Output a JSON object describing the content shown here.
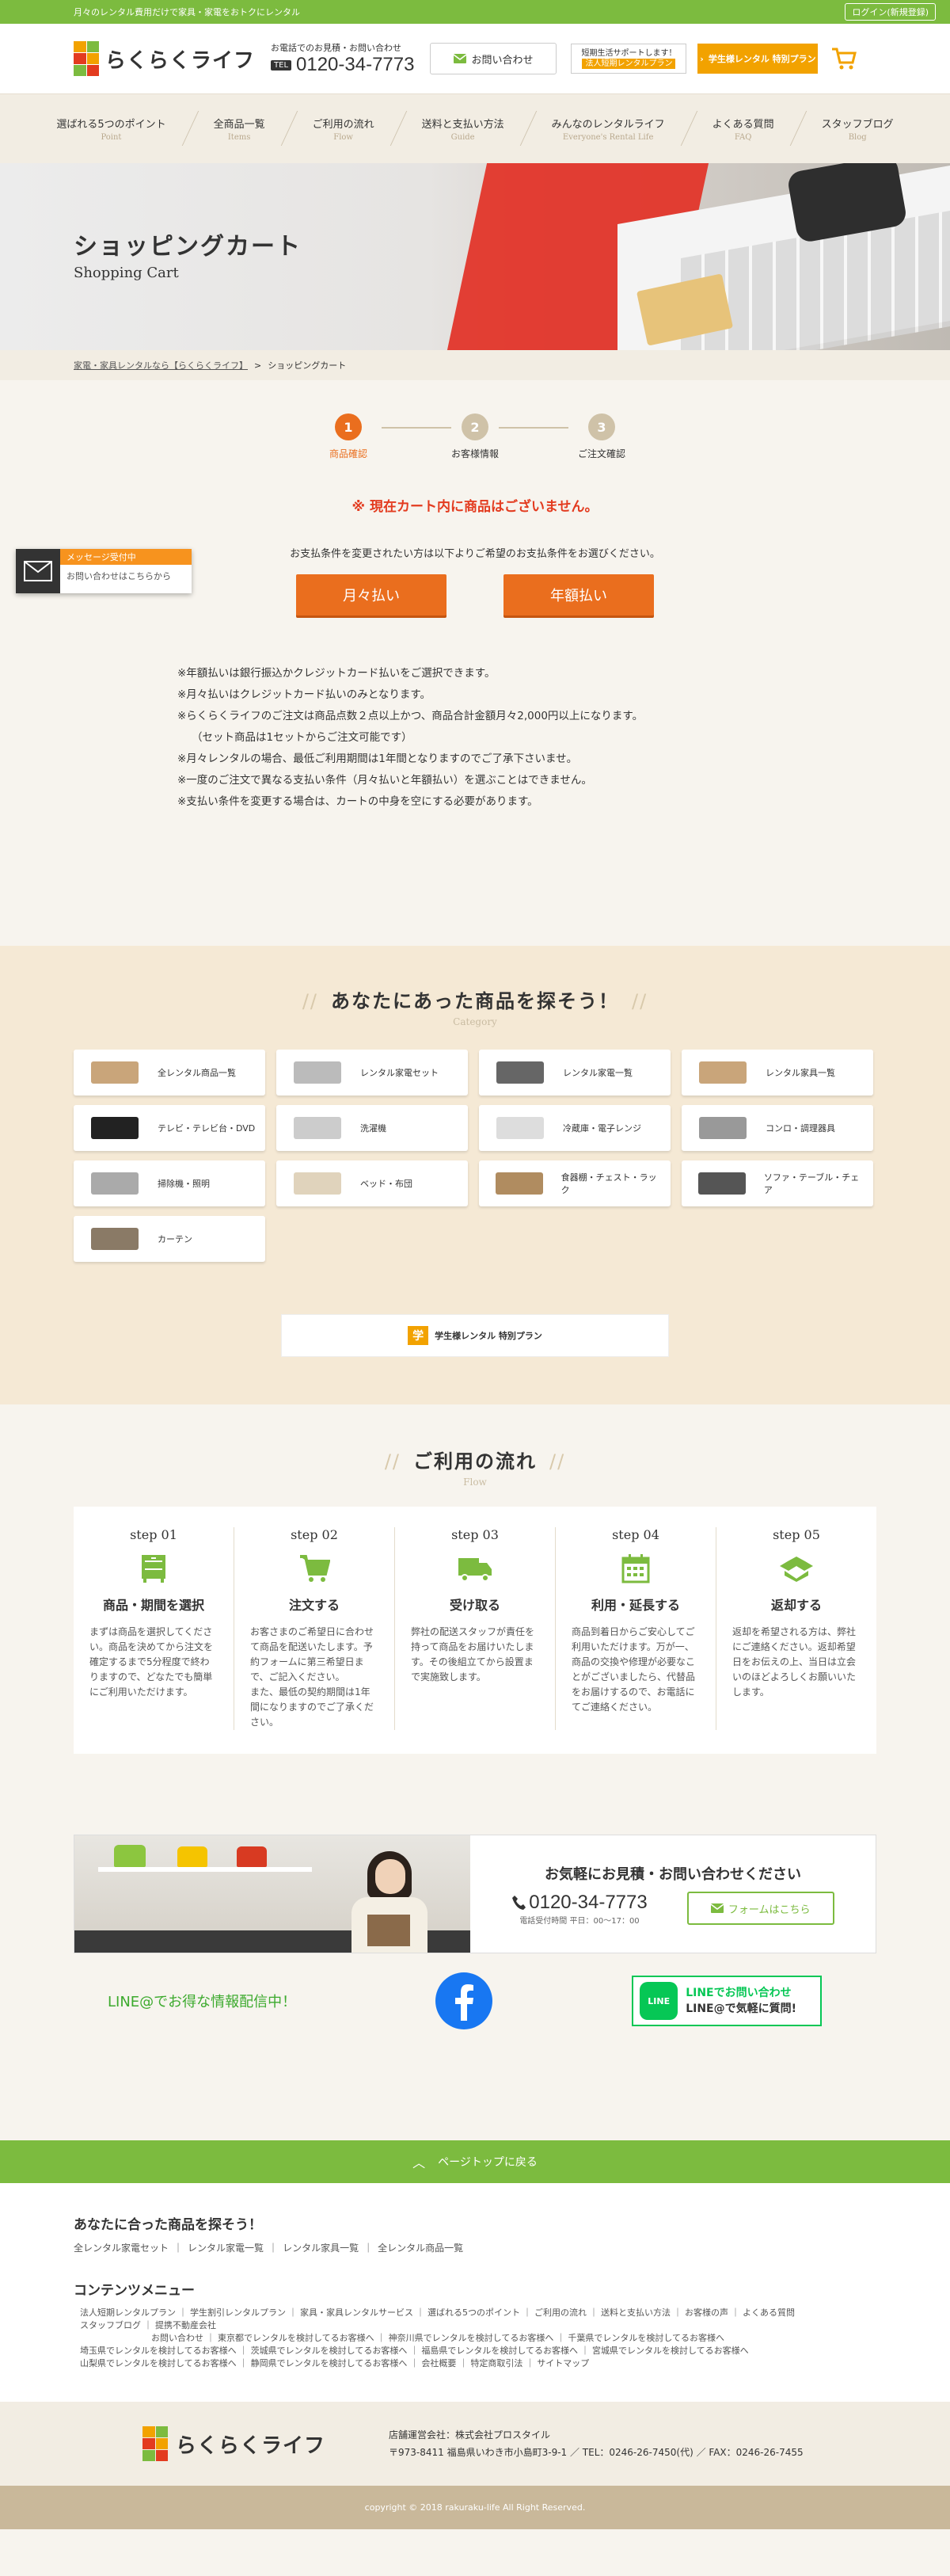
{
  "topbar": {
    "tagline": "月々のレンタル費用だけで家具・家電をおトクにレンタル",
    "login": "ログイン(新規登録)"
  },
  "header": {
    "logo_text": "らくらくライフ",
    "tel_caption": "お電話でのお見積・お問い合わせ",
    "tel_badge": "TEL",
    "tel_number": "0120-34-7773",
    "contact_label": "お問い合わせ",
    "short_banner_line1": "短期生活サポートします！",
    "short_banner_line2": "法人短期レンタルプラン",
    "student_banner": "学生様レンタル 特別プラン"
  },
  "nav": [
    {
      "ja": "選ばれる5つのポイント",
      "en": "Point"
    },
    {
      "ja": "全商品一覧",
      "en": "Items"
    },
    {
      "ja": "ご利用の流れ",
      "en": "Flow"
    },
    {
      "ja": "送料と支払い方法",
      "en": "Guide"
    },
    {
      "ja": "みんなのレンタルライフ",
      "en": "Everyone's Rental Life"
    },
    {
      "ja": "よくある質問",
      "en": "FAQ"
    },
    {
      "ja": "スタッフブログ",
      "en": "Blog"
    }
  ],
  "hero": {
    "title": "ショッピングカート",
    "subtitle": "Shopping Cart"
  },
  "breadcrumb": {
    "home": "家電・家具レンタルなら【らくらくライフ】",
    "sep": ">",
    "current": "ショッピングカート"
  },
  "steps": [
    {
      "num": "1",
      "label": "商品確認"
    },
    {
      "num": "2",
      "label": "お客様情報"
    },
    {
      "num": "3",
      "label": "ご注文確認"
    }
  ],
  "cart": {
    "empty_notice": "※ 現在カート内に商品はございません。",
    "pay_info": "お支払条件を変更されたい方は以下よりご希望のお支払条件をお選びください。",
    "monthly_btn": "月々払い",
    "yearly_btn": "年額払い",
    "notes": [
      "※年額払いは銀行振込かクレジットカード払いをご選択できます。",
      "※月々払いはクレジットカード払いのみとなります。",
      "※らくらくライフのご注文は商品点数２点以上かつ、商品合計金額月々2,000円以上になります。",
      "（セット商品は1セットからご注文可能です）",
      "※月々レンタルの場合、最低ご利用期間は1年間となりますのでご了承下さいませ。",
      "※一度のご注文で異なる支払い条件（月々払いと年額払い）を選ぶことはできません。",
      "※支払い条件を変更する場合は、カートの中身を空にする必要があります。"
    ]
  },
  "message_widget": {
    "status": "メッセージ受付中",
    "text": "お問い合わせはこちらから"
  },
  "category": {
    "title": "あなたにあった商品を探そう！",
    "subtitle": "Category",
    "items": [
      "全レンタル商品一覧",
      "レンタル家電セット",
      "レンタル家電一覧",
      "レンタル家具一覧",
      "テレビ・テレビ台・DVD",
      "洗濯機",
      "冷蔵庫・電子レンジ",
      "コンロ・調理器具",
      "掃除機・照明",
      "ベッド・布団",
      "食器棚・チェスト・ラック",
      "ソファ・テーブル・チェア",
      "カーテン"
    ]
  },
  "flow": {
    "title": "ご利用の流れ",
    "subtitle": "Flow",
    "steps": [
      {
        "num": "step 01",
        "title": "商品・期間を選択",
        "desc": "まずは商品を選択してください。商品を決めてから注文を確定するまで5分程度で終わりますので、どなたでも簡単にご利用いただけます。"
      },
      {
        "num": "step 02",
        "title": "注文する",
        "desc": "お客さまのご希望日に合わせて商品を配送いたします。予約フォームに第三希望日まで、ご記入ください。\nまた、最低の契約期間は1年間になりますのでご了承ください。"
      },
      {
        "num": "step 03",
        "title": "受け取る",
        "desc": "弊社の配送スタッフが責任を持って商品をお届けいたします。その後組立てから設置まで実施致します。"
      },
      {
        "num": "step 04",
        "title": "利用・延長する",
        "desc": "商品到着日からご安心してご利用いただけます。万が一、商品の交換や修理が必要なことがございましたら、代替品をお届けするので、お電話にてご連絡ください。"
      },
      {
        "num": "step 05",
        "title": "返却する",
        "desc": "返却を希望される方は、弊社にご連絡ください。返却希望日をお伝えの上、当日は立会いのほどよろしくお願いいたします。"
      }
    ]
  },
  "contact": {
    "title": "お気軽にお見積・お問い合わせください",
    "tel": "0120-34-7773",
    "hours": "電話受付時間 平日：00～17：00",
    "form_btn": "フォームはこちら"
  },
  "sns": {
    "line_text": "LINE@でお得な情報配信中！",
    "line_btn1": "LINEでお問い合わせ",
    "line_btn2": "LINE@で気軽に質問!"
  },
  "pagetop": "ページトップに戻る",
  "footer": {
    "find_title": "あなたに合った商品を探そう！",
    "find_links": [
      "全レンタル家電セット",
      "レンタル家電一覧",
      "レンタル家具一覧",
      "全レンタル商品一覧"
    ],
    "menu_title": "コンテンツメニュー",
    "menu_rows": [
      "法人短期レンタルプラン ｜ 学生割引レンタルプラン ｜ 家具・家具レンタルサービス ｜ 選ばれる5つのポイント ｜ ご利用の流れ ｜ 送料と支払い方法 ｜ お客様の声 ｜ よくある質問",
      "スタッフブログ ｜ 提携不動産会社",
      "お問い合わせ ｜ 東京都でレンタルを検討してるお客様へ ｜ 神奈川県でレンタルを検討してるお客様へ ｜ 千葉県でレンタルを検討してるお客様へ",
      "埼玉県でレンタルを検討してるお客様へ ｜ 茨城県でレンタルを検討してるお客様へ ｜ 福島県でレンタルを検討してるお客様へ ｜ 宮城県でレンタルを検討してるお客様へ",
      "山梨県でレンタルを検討してるお客様へ ｜ 静岡県でレンタルを検討してるお客様へ ｜ 会社概要 ｜ 特定商取引法 ｜ サイトマップ"
    ],
    "logo_text": "らくらくライフ",
    "company": "店舗運営会社：株式会社プロスタイル",
    "address": "〒973-8411 福島県いわき市小島町3-9-1 ／ TEL：0246-26-7450(代) ／ FAX：0246-26-7455",
    "copyright": "copyright © 2018 rakuraku-life All Right Reserved."
  },
  "colors": {
    "green": "#7cbb3f",
    "orange": "#ea6e1e",
    "red_notice": "#e33b1f",
    "beige": "#f5e9d5"
  }
}
